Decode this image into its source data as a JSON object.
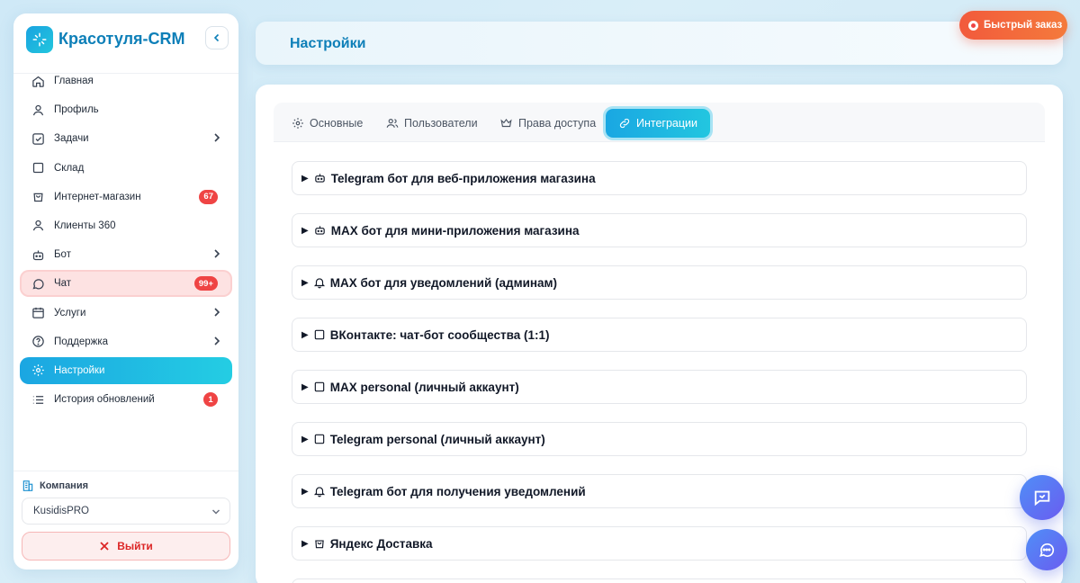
{
  "app": {
    "name": "Красотуля-CRM"
  },
  "sidebar": {
    "items": [
      {
        "label": "Главная",
        "icon": "home-icon"
      },
      {
        "label": "Профиль",
        "icon": "user-icon"
      },
      {
        "label": "Задачи",
        "icon": "checkbox-icon",
        "has_submenu": true
      },
      {
        "label": "Склад",
        "icon": "square-icon"
      },
      {
        "label": "Интернет-магазин",
        "icon": "bag-icon",
        "badge": "67"
      },
      {
        "label": "Клиенты 360",
        "icon": "user-icon"
      },
      {
        "label": "Бот",
        "icon": "bot-icon",
        "has_submenu": true
      },
      {
        "label": "Чат",
        "icon": "chat-bubble-icon",
        "badge": "99+",
        "highlight": true
      },
      {
        "label": "Услуги",
        "icon": "calendar-icon",
        "has_submenu": true
      },
      {
        "label": "Поддержка",
        "icon": "help-circle-icon",
        "has_submenu": true
      },
      {
        "label": "Настройки",
        "icon": "gear-icon",
        "active": true
      },
      {
        "label": "История обновлений",
        "icon": "list-icon",
        "badge": "1"
      }
    ],
    "company": {
      "label": "Компания",
      "selected": "KusidisPRO"
    },
    "logout_label": "Выйти"
  },
  "header": {
    "title": "Настройки",
    "quick_order_label": "Быстрый заказ"
  },
  "tabs": [
    {
      "label": "Основные",
      "icon": "gear-icon"
    },
    {
      "label": "Пользователи",
      "icon": "users-icon"
    },
    {
      "label": "Права доступа",
      "icon": "crown-icon"
    },
    {
      "label": "Интеграции",
      "icon": "link-icon",
      "active": true
    }
  ],
  "integrations": [
    {
      "label": "Telegram бот для веб-приложения магазина",
      "icon": "bot-icon"
    },
    {
      "label": "MAX бот для мини-приложения магазина",
      "icon": "bot-icon"
    },
    {
      "label": "MAX бот для уведомлений (админам)",
      "icon": "bell-icon"
    },
    {
      "label": "ВКонтакте: чат-бот сообщества (1:1)",
      "icon": "square-icon"
    },
    {
      "label": "MAX personal (личный аккаунт)",
      "icon": "square-icon"
    },
    {
      "label": "Telegram personal (личный аккаунт)",
      "icon": "square-icon"
    },
    {
      "label": "Telegram бот для получения уведомлений",
      "icon": "bell-icon"
    },
    {
      "label": "Яндекс Доставка",
      "icon": "bag-icon"
    }
  ],
  "colors": {
    "accent": "#1aa7e2",
    "brand": "#0d7fb8",
    "danger": "#ef4444",
    "quick_order": "#f25a3c"
  }
}
